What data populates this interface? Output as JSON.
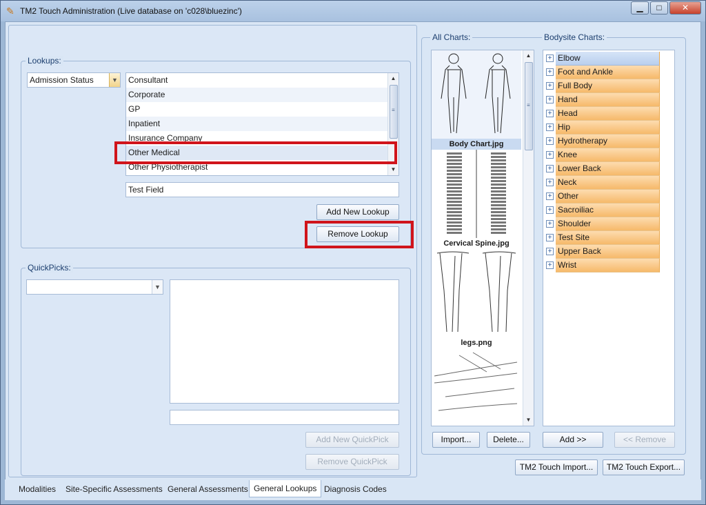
{
  "window": {
    "title": "TM2 Touch Administration (Live database on 'c028\\bluezinc')",
    "buttons": {
      "minimize": "▁",
      "maximize": "□",
      "close": "✕"
    }
  },
  "lookups": {
    "group_label": "Lookups:",
    "type_selected": "Admission Status",
    "items": [
      "Consultant",
      "Corporate",
      "GP",
      "Inpatient",
      "Insurance Company",
      "Other Medical",
      "Other Physiotherapist"
    ],
    "selected_item": "Other Medical",
    "edit_value": "Test Field",
    "add_button": "Add New Lookup",
    "remove_button": "Remove Lookup"
  },
  "quickpicks": {
    "group_label": "QuickPicks:",
    "combo_value": "",
    "text_value": "",
    "add_button": "Add New QuickPick",
    "remove_button": "Remove QuickPick"
  },
  "all_charts": {
    "label": "All Charts:",
    "items": [
      {
        "caption": "Body Chart.jpg",
        "selected": true
      },
      {
        "caption": "Cervical Spine.jpg",
        "selected": false
      },
      {
        "caption": "legs.png",
        "selected": false
      },
      {
        "caption": "",
        "selected": false
      }
    ],
    "import_button": "Import...",
    "delete_button": "Delete..."
  },
  "bodysite_charts": {
    "label": "Bodysite Charts:",
    "items": [
      "Elbow",
      "Foot and Ankle",
      "Full Body",
      "Hand",
      "Head",
      "Hip",
      "Hydrotherapy",
      "Knee",
      "Lower Back",
      "Neck",
      "Other",
      "Sacroiliac",
      "Shoulder",
      "Test Site",
      "Upper Back",
      "Wrist"
    ],
    "selected_item": "Elbow",
    "add_button": "Add  >>",
    "remove_button": "<< Remove"
  },
  "footer_buttons": {
    "import": "TM2 Touch Import...",
    "export": "TM2 Touch Export..."
  },
  "tabs": [
    "Modalities",
    "Site-Specific Assessments",
    "General Assessments",
    "General Lookups",
    "Diagnosis Codes"
  ],
  "active_tab": "General Lookups",
  "colors": {
    "highlight": "#d0141b",
    "tree_item": "#f6b96a",
    "tree_selected": "#b9cfee"
  }
}
